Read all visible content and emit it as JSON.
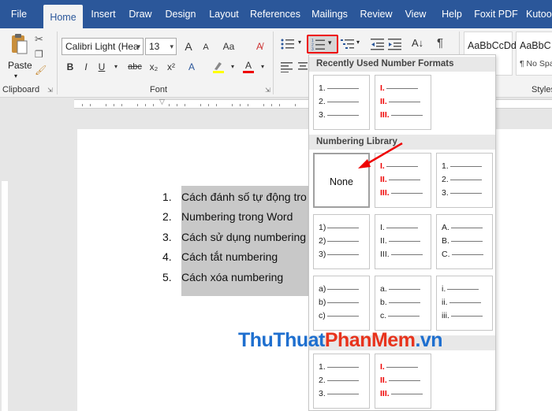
{
  "tabs": [
    {
      "label": "File",
      "active": false
    },
    {
      "label": "Home",
      "active": true
    },
    {
      "label": "Insert",
      "active": false
    },
    {
      "label": "Draw",
      "active": false
    },
    {
      "label": "Design",
      "active": false
    },
    {
      "label": "Layout",
      "active": false
    },
    {
      "label": "References",
      "active": false
    },
    {
      "label": "Mailings",
      "active": false
    },
    {
      "label": "Review",
      "active": false
    },
    {
      "label": "View",
      "active": false
    },
    {
      "label": "Help",
      "active": false
    },
    {
      "label": "Foxit PDF",
      "active": false
    },
    {
      "label": "Kutoo",
      "active": false
    }
  ],
  "ribbon": {
    "paste_label": "Paste",
    "clipboard_label": "Clipboard",
    "font_group_label": "Font",
    "styles_label": "Styles",
    "font_name": "Calibri Light (Hea",
    "font_size": "13",
    "grow_font": "A",
    "shrink_font": "A",
    "change_case": "Aa",
    "bold": "B",
    "italic": "I",
    "underline": "U",
    "strikethrough": "abc",
    "subscript": "x₂",
    "superscript": "x²",
    "font_color": "A",
    "styles": [
      {
        "preview": "AaBbCcDd",
        "name": ""
      },
      {
        "preview": "AaBbC",
        "name": "¶ No Spac"
      }
    ]
  },
  "document": {
    "list_items": [
      {
        "num": "1.",
        "text": "Cách đánh số tự động tro"
      },
      {
        "num": "2.",
        "text": "Numbering trong Word"
      },
      {
        "num": "3.",
        "text": "Cách sử dụng numbering"
      },
      {
        "num": "4.",
        "text": "Cách tắt numbering"
      },
      {
        "num": "5.",
        "text": "Cách xóa numbering"
      }
    ]
  },
  "numbering_menu": {
    "recent_header": "Recently Used Number Formats",
    "library_header": "Numbering Library",
    "none_label": "None",
    "recent": [
      {
        "labels": [
          "1.",
          "2.",
          "3."
        ],
        "red": false
      },
      {
        "labels": [
          "I.",
          "II.",
          "III."
        ],
        "red": true
      }
    ],
    "library": [
      {
        "labels": [
          "I.",
          "II.",
          "III."
        ],
        "red": true
      },
      {
        "labels": [
          "1.",
          "2.",
          "3."
        ],
        "red": false
      },
      {
        "labels": [
          "1)",
          "2)",
          "3)"
        ],
        "red": false
      },
      {
        "labels": [
          "I.",
          "II.",
          "III."
        ],
        "red": false
      },
      {
        "labels": [
          "A.",
          "B.",
          "C."
        ],
        "red": false
      },
      {
        "labels": [
          "a)",
          "b)",
          "c)"
        ],
        "red": false
      },
      {
        "labels": [
          "a.",
          "b.",
          "c."
        ],
        "red": false
      },
      {
        "labels": [
          "i.",
          "ii.",
          "iii."
        ],
        "red": false
      }
    ],
    "document": [
      {
        "labels": [
          "1.",
          "2.",
          "3."
        ],
        "red": false
      },
      {
        "labels": [
          "I.",
          "II.",
          "III."
        ],
        "red": true
      }
    ]
  },
  "watermark": {
    "part1": "ThuThuat",
    "part2": "PhanMem",
    "part3": ".vn"
  },
  "colors": {
    "accent": "#2b579a",
    "highlight_red": "#e00000"
  }
}
